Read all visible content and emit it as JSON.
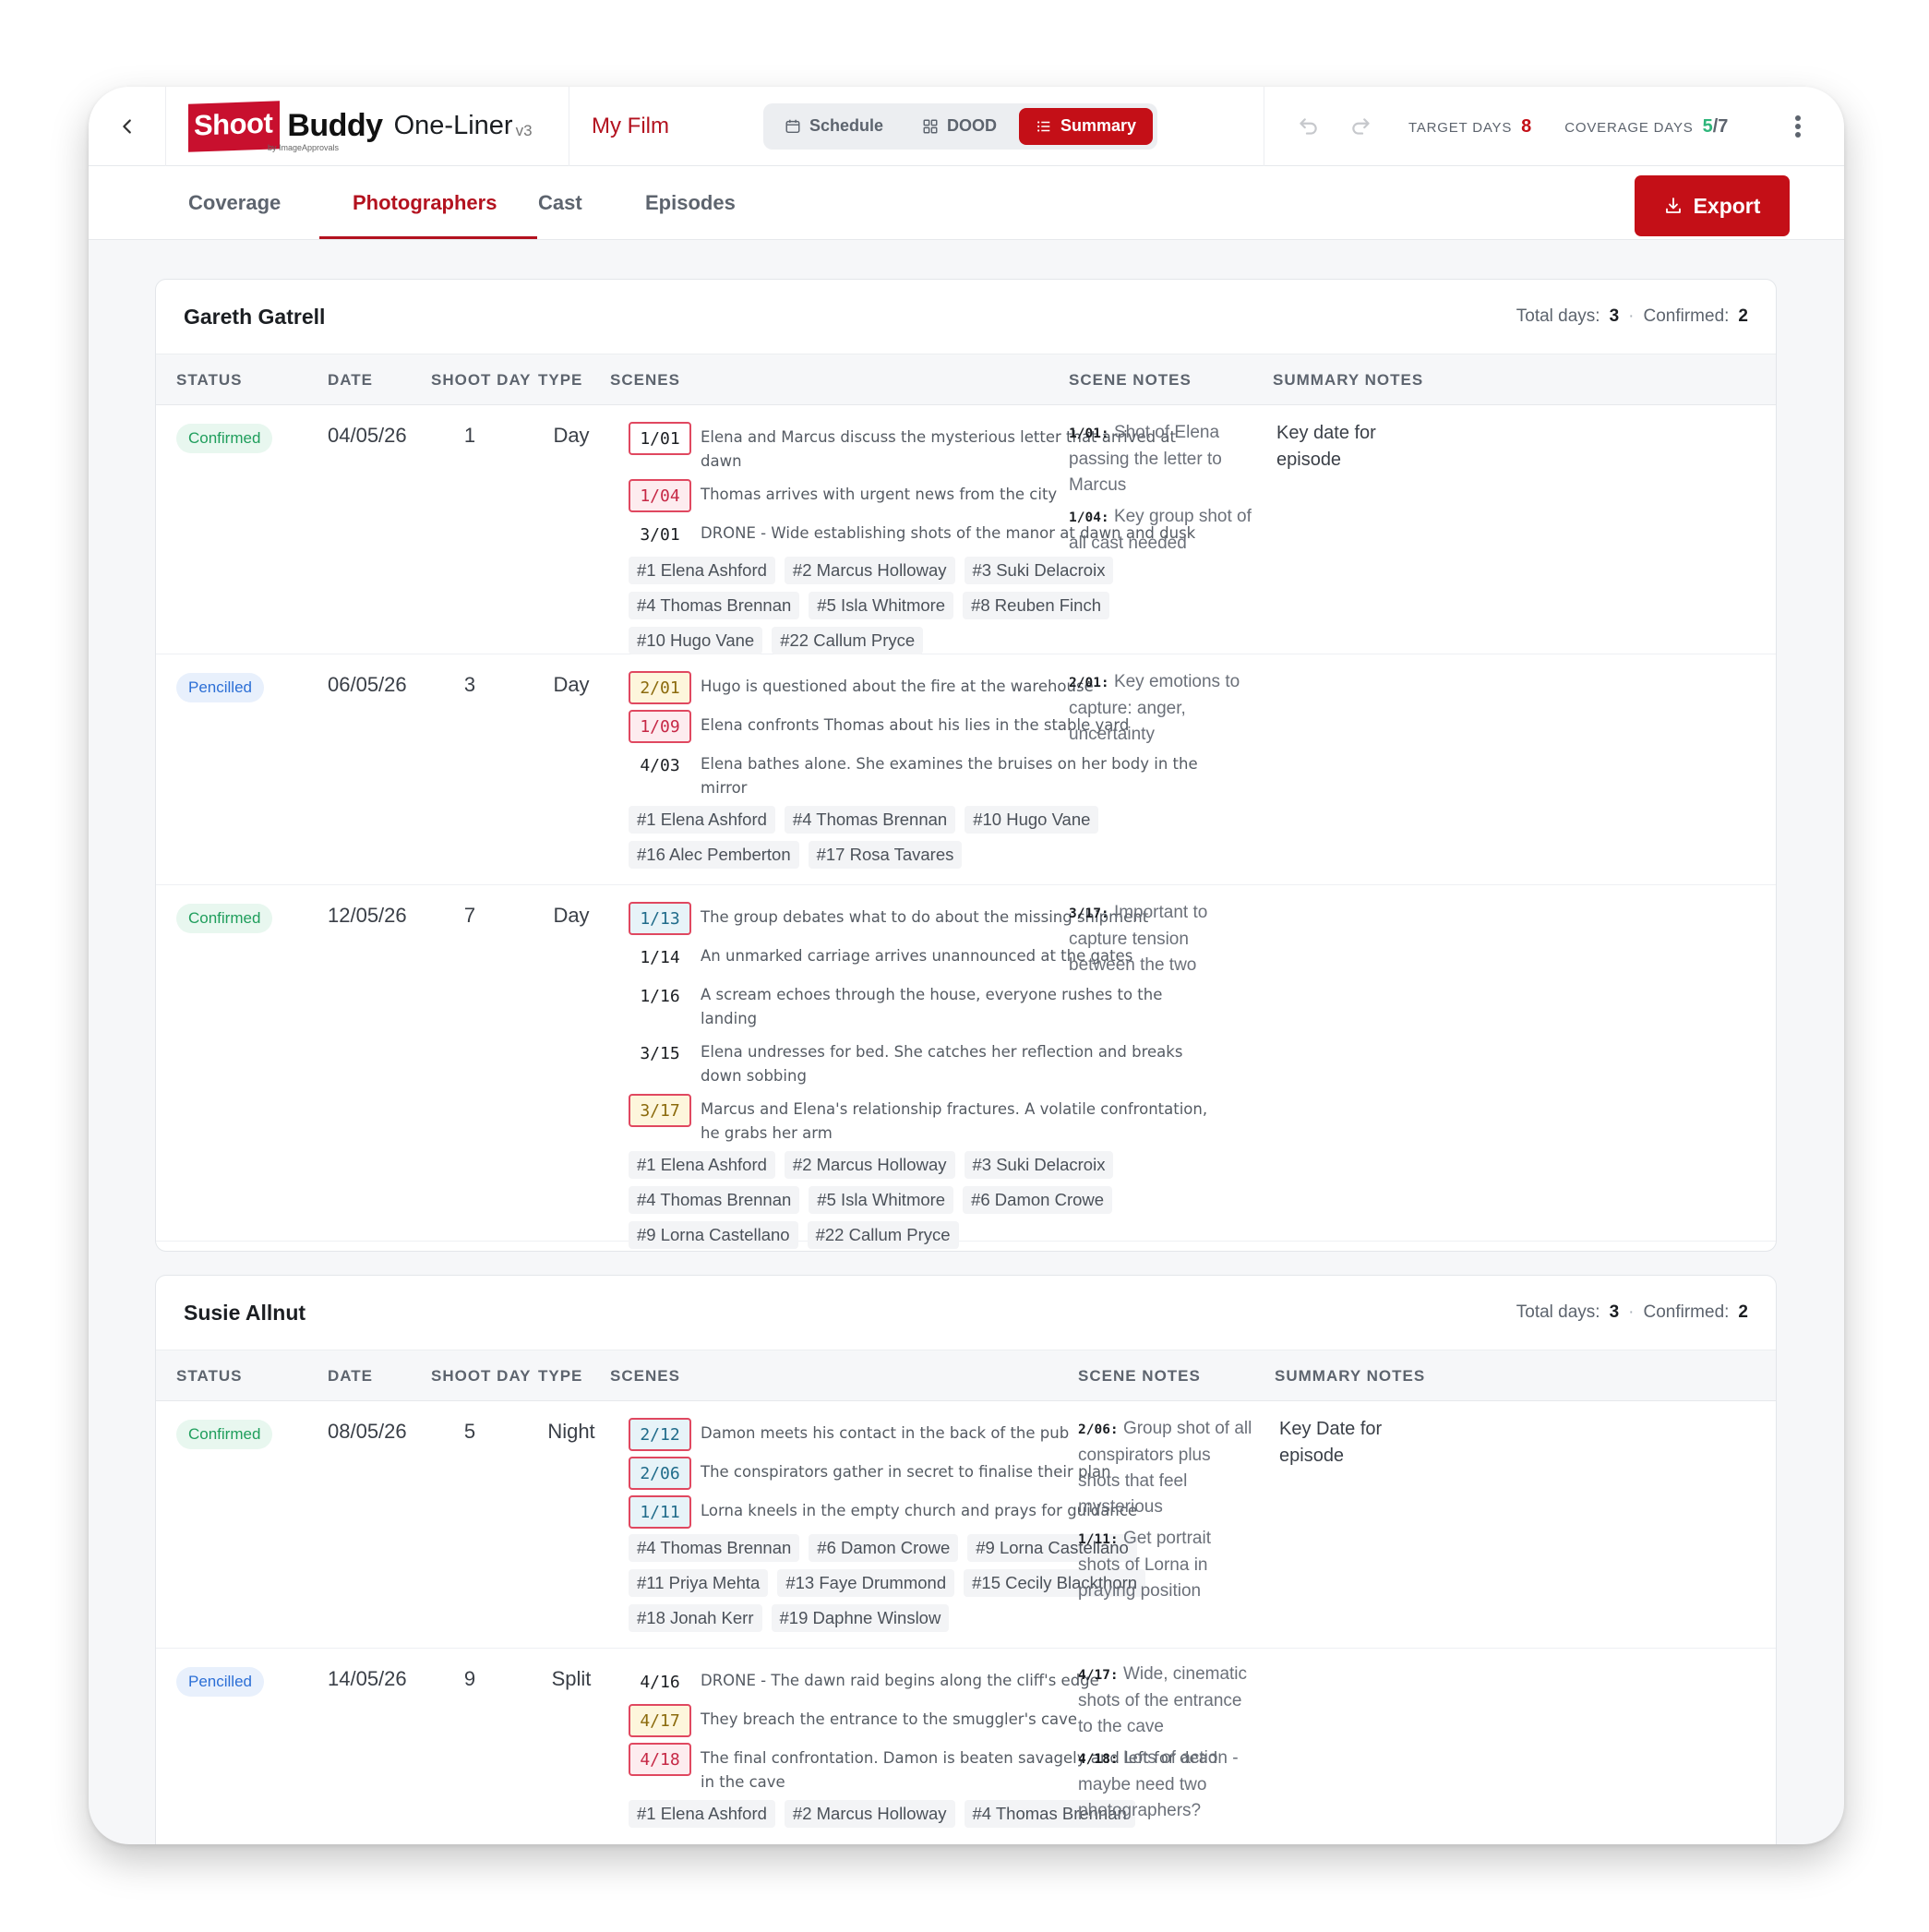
{
  "header": {
    "logo_shoot": "Shoot",
    "logo_buddy": "Buddy",
    "logo_sub": "by ImageApprovals",
    "product": "One-Liner",
    "version": "v3",
    "project": "My Film",
    "views": [
      {
        "label": "Schedule",
        "icon": "calendar-icon"
      },
      {
        "label": "DOOD",
        "icon": "grid-icon"
      },
      {
        "label": "Summary",
        "icon": "list-icon",
        "active": true
      }
    ],
    "target_days_label": "TARGET DAYS",
    "target_days_value": "8",
    "coverage_days_label": "COVERAGE DAYS",
    "coverage_days_value": "5",
    "coverage_days_sep": "/",
    "coverage_days_total": "7"
  },
  "tabs": [
    {
      "label": "Coverage"
    },
    {
      "label": "Photographers",
      "active": true
    },
    {
      "label": "Cast"
    },
    {
      "label": "Episodes"
    }
  ],
  "export_label": "Export",
  "colors": {
    "brand_red": "#c40f17",
    "confirmed_green": "#1f9e5c",
    "pencilled_blue": "#2c6fd6",
    "coverage_green": "#2fb67b"
  },
  "columns": {
    "status": "STATUS",
    "date": "DATE",
    "shoot_day": "SHOOT DAY",
    "type": "TYPE",
    "scenes": "SCENES",
    "scene_notes": "SCENE NOTES",
    "summary_notes": "SUMMARY NOTES"
  },
  "photographers": [
    {
      "name": "Gareth Gatrell",
      "total_label": "Total days:",
      "total_value": "3",
      "confirmed_label": "Confirmed:",
      "confirmed_value": "2",
      "rows": [
        {
          "status": "Confirmed",
          "date": "04/05/26",
          "shoot_day": "1",
          "type": "Day",
          "scenes": [
            {
              "code": "1/01",
              "style": "plain-box",
              "desc": "Elena and Marcus discuss the mysterious letter that arrived at dawn"
            },
            {
              "code": "1/04",
              "style": "red",
              "desc": "Thomas arrives with urgent news from the city"
            },
            {
              "code": "3/01",
              "style": "plain",
              "desc": "DRONE - Wide establishing shots of the manor at dawn and dusk"
            }
          ],
          "cast": [
            "#1 Elena Ashford",
            "#2 Marcus Holloway",
            "#3 Suki Delacroix",
            "#4 Thomas Brennan",
            "#5 Isla Whitmore",
            "#8 Reuben Finch",
            "#10 Hugo Vane",
            "#22 Callum Pryce"
          ],
          "scene_notes": [
            {
              "key": "1/01:",
              "text": "Shot of Elena passing the letter to Marcus"
            },
            {
              "key": "1/04:",
              "text": "Key group shot of all cast needed"
            }
          ],
          "summary_notes": "Key date for episode"
        },
        {
          "status": "Pencilled",
          "date": "06/05/26",
          "shoot_day": "3",
          "type": "Day",
          "scenes": [
            {
              "code": "2/01",
              "style": "yellow",
              "desc": "Hugo is questioned about the fire at the warehouse"
            },
            {
              "code": "1/09",
              "style": "red",
              "desc": "Elena confronts Thomas about his lies in the stable yard"
            },
            {
              "code": "4/03",
              "style": "plain",
              "desc": "Elena bathes alone. She examines the bruises on her body in the mirror"
            }
          ],
          "cast": [
            "#1 Elena Ashford",
            "#4 Thomas Brennan",
            "#10 Hugo Vane",
            "#16 Alec Pemberton",
            "#17 Rosa Tavares"
          ],
          "scene_notes": [
            {
              "key": "2/01:",
              "text": "Key emotions to capture: anger, uncertainty"
            }
          ],
          "summary_notes": ""
        },
        {
          "status": "Confirmed",
          "date": "12/05/26",
          "shoot_day": "7",
          "type": "Day",
          "scenes": [
            {
              "code": "1/13",
              "style": "blue",
              "desc": "The group debates what to do about the missing shipment"
            },
            {
              "code": "1/14",
              "style": "plain",
              "desc": "An unmarked carriage arrives unannounced at the gates"
            },
            {
              "code": "1/16",
              "style": "plain",
              "desc": "A scream echoes through the house, everyone rushes to the landing"
            },
            {
              "code": "3/15",
              "style": "plain",
              "desc": "Elena undresses for bed. She catches her reflection and breaks down sobbing"
            },
            {
              "code": "3/17",
              "style": "yellow",
              "desc": "Marcus and Elena's relationship fractures. A volatile confrontation, he grabs her arm"
            }
          ],
          "cast": [
            "#1 Elena Ashford",
            "#2 Marcus Holloway",
            "#3 Suki Delacroix",
            "#4 Thomas Brennan",
            "#5 Isla Whitmore",
            "#6 Damon Crowe",
            "#9 Lorna Castellano",
            "#22 Callum Pryce"
          ],
          "scene_notes": [
            {
              "key": "3/17:",
              "text": "Important to capture tension between the two"
            }
          ],
          "summary_notes": ""
        }
      ]
    },
    {
      "name": "Susie Allnut",
      "total_label": "Total days:",
      "total_value": "3",
      "confirmed_label": "Confirmed:",
      "confirmed_value": "2",
      "rows": [
        {
          "status": "Confirmed",
          "date": "08/05/26",
          "shoot_day": "5",
          "type": "Night",
          "scenes": [
            {
              "code": "2/12",
              "style": "blue",
              "desc": "Damon meets his contact in the back of the pub"
            },
            {
              "code": "2/06",
              "style": "blue",
              "desc": "The conspirators gather in secret to finalise their plan"
            },
            {
              "code": "1/11",
              "style": "blue",
              "desc": "Lorna kneels in the empty church and prays for guidance"
            }
          ],
          "cast": [
            "#4 Thomas Brennan",
            "#6 Damon Crowe",
            "#9 Lorna Castellano",
            "#11 Priya Mehta",
            "#13 Faye Drummond",
            "#15 Cecily Blackthorn",
            "#18 Jonah Kerr",
            "#19 Daphne Winslow"
          ],
          "scene_notes": [
            {
              "key": "2/06:",
              "text": "Group shot of all conspirators plus shots that feel mysterious"
            },
            {
              "key": "1/11:",
              "text": "Get portrait shots of Lorna in praying position"
            }
          ],
          "summary_notes": "Key Date for episode"
        },
        {
          "status": "Pencilled",
          "date": "14/05/26",
          "shoot_day": "9",
          "type": "Split",
          "scenes": [
            {
              "code": "4/16",
              "style": "plain",
              "desc": "DRONE - The dawn raid begins along the cliff's edge"
            },
            {
              "code": "4/17",
              "style": "yellow",
              "desc": "They breach the entrance to the smuggler's cave"
            },
            {
              "code": "4/18",
              "style": "red",
              "desc": "The final confrontation. Damon is beaten savagely and left for dead in the cave"
            }
          ],
          "cast": [
            "#1 Elena Ashford",
            "#2 Marcus Holloway",
            "#4 Thomas Brennan"
          ],
          "scene_notes": [
            {
              "key": "4/17:",
              "text": "Wide, cinematic shots of the entrance to the cave"
            },
            {
              "key": "4/18:",
              "text": "Lots of action - maybe need two photographers?"
            }
          ],
          "summary_notes": ""
        }
      ]
    }
  ]
}
